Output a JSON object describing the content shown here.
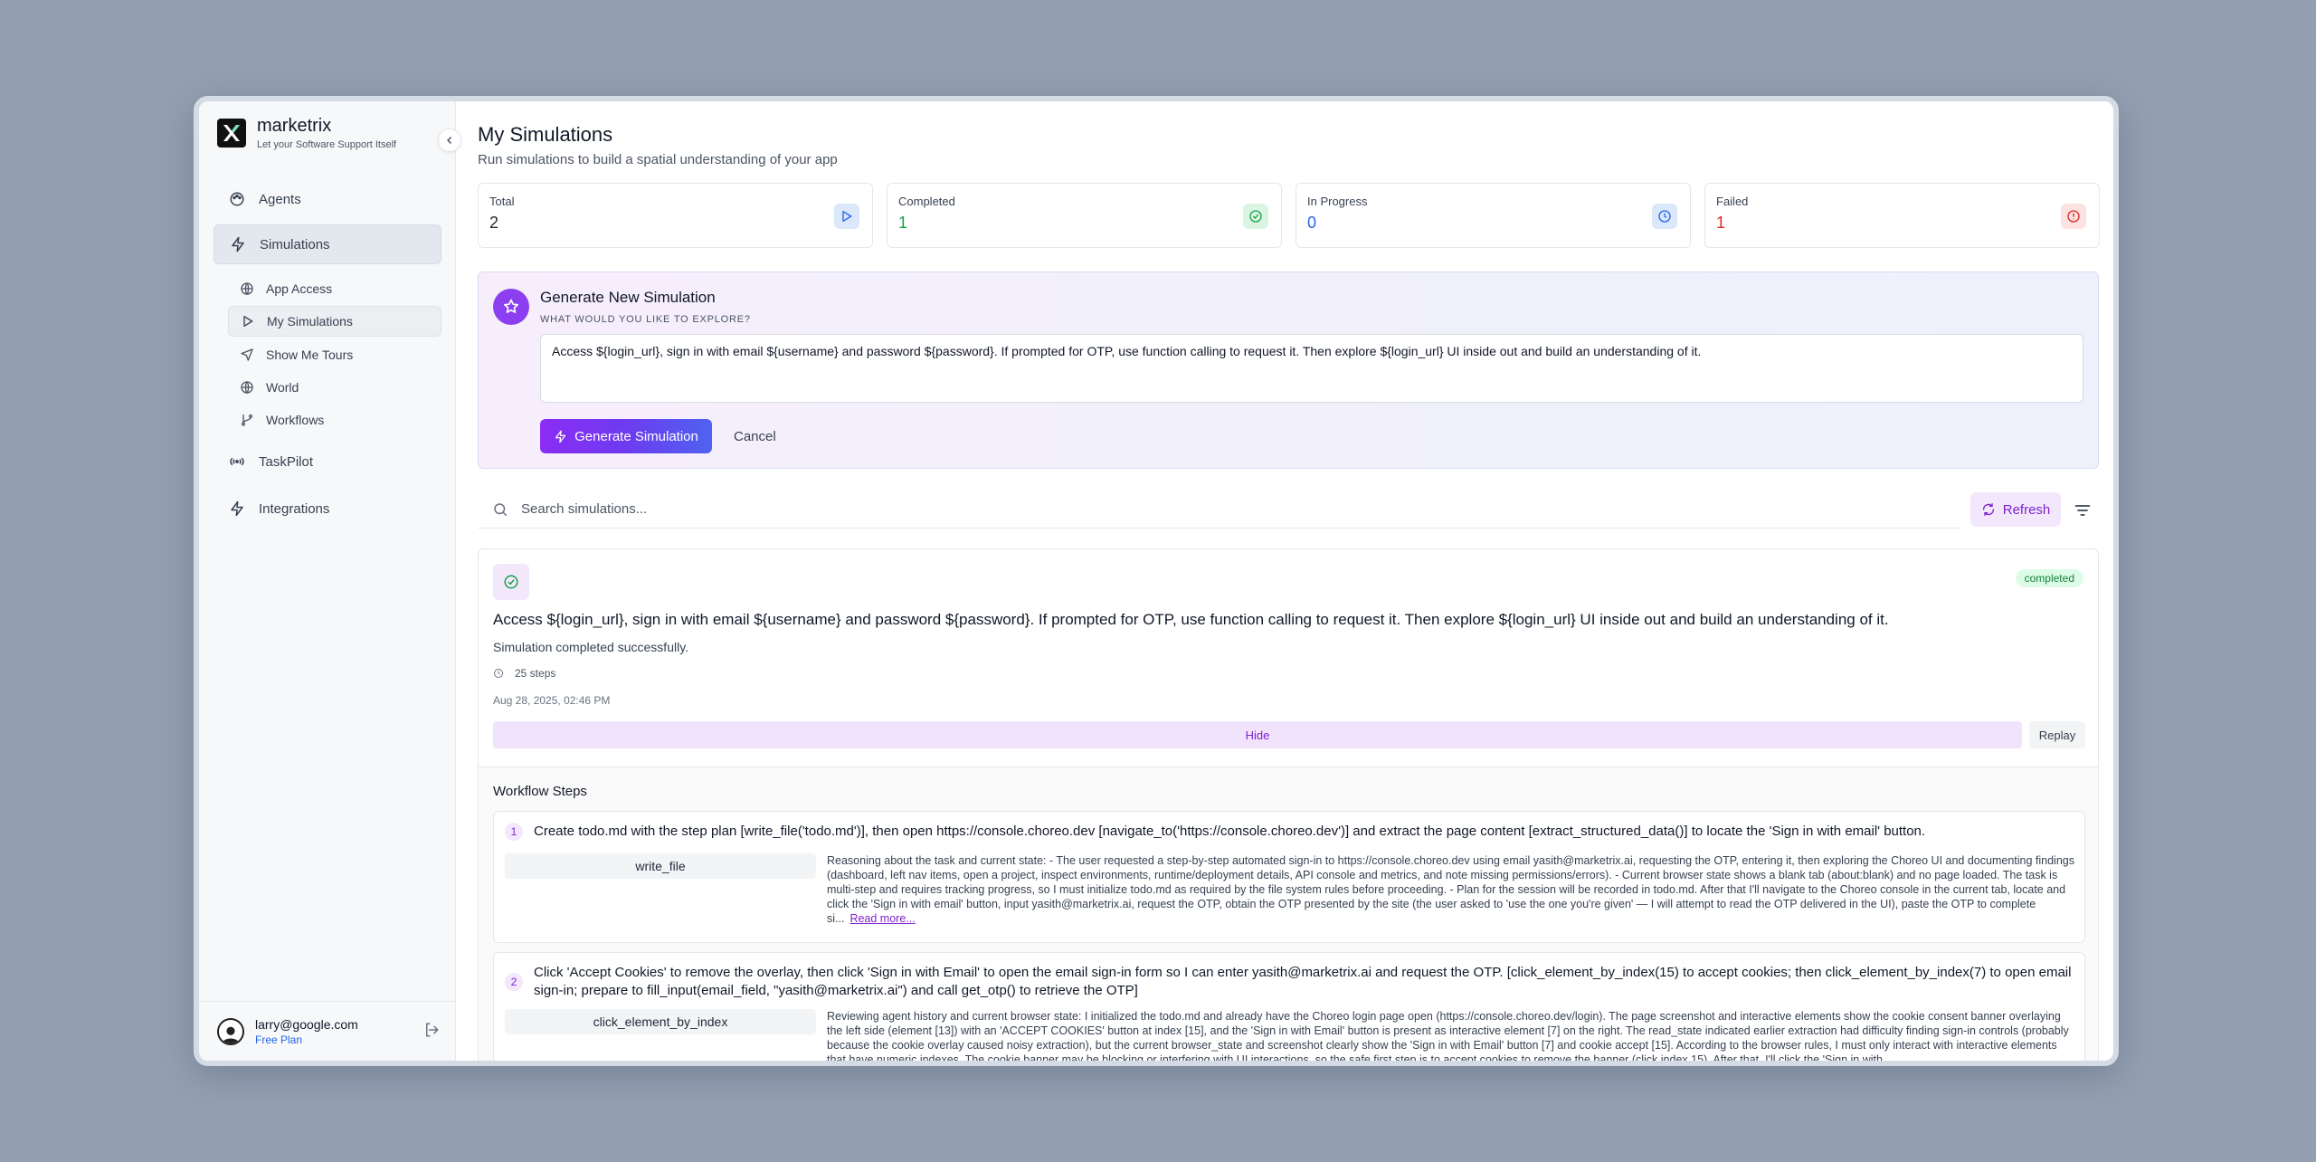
{
  "brand": {
    "name": "marketrix",
    "tagline": "Let your Software Support Itself"
  },
  "sidebar": {
    "items": [
      {
        "label": "Agents",
        "icon": "palette-icon"
      },
      {
        "label": "Simulations",
        "icon": "zap-icon",
        "active": true
      },
      {
        "label": "TaskPilot",
        "icon": "wave-icon"
      },
      {
        "label": "Integrations",
        "icon": "zap-icon"
      }
    ],
    "sub_items": [
      {
        "label": "App Access",
        "icon": "globe-icon"
      },
      {
        "label": "My Simulations",
        "icon": "play-icon",
        "active": true
      },
      {
        "label": "Show Me Tours",
        "icon": "send-icon"
      },
      {
        "label": "World",
        "icon": "globe-icon"
      },
      {
        "label": "Workflows",
        "icon": "git-branch-icon"
      }
    ]
  },
  "user": {
    "email": "larry@google.com",
    "plan": "Free Plan"
  },
  "page": {
    "title": "My Simulations",
    "subtitle": "Run simulations to build a spatial understanding of your app"
  },
  "stats": [
    {
      "label": "Total",
      "value": "2",
      "color": "#1f2937",
      "icon": "play-icon"
    },
    {
      "label": "Completed",
      "value": "1",
      "color": "#16a34a",
      "icon": "check-circle-icon"
    },
    {
      "label": "In Progress",
      "value": "0",
      "color": "#2563eb",
      "icon": "clock-icon"
    },
    {
      "label": "Failed",
      "value": "1",
      "color": "#dc2626",
      "icon": "alert-circle-icon"
    }
  ],
  "generate": {
    "title": "Generate New Simulation",
    "question": "WHAT WOULD YOU LIKE TO EXPLORE?",
    "prompt_value": "Access ${login_url}, sign in with email ${username} and password ${password}. If prompted for OTP, use function calling to request it. Then explore ${login_url} UI inside out and build an understanding of it.",
    "button_label": "Generate Simulation",
    "cancel_label": "Cancel"
  },
  "search": {
    "placeholder": "Search simulations...",
    "refresh_label": "Refresh"
  },
  "simulation": {
    "status": "completed",
    "prompt": "Access ${login_url}, sign in with email ${username} and password ${password}. If prompted for OTP, use function calling to request it. Then explore ${login_url} UI inside out and build an understanding of it.",
    "message": "Simulation completed successfully.",
    "steps": "25 steps",
    "date": "Aug 28, 2025, 02:46 PM",
    "hide_label": "Hide",
    "replay_label": "Replay"
  },
  "workflow": {
    "title": "Workflow Steps",
    "steps": [
      {
        "num": "1",
        "desc": "Create todo.md with the step plan [write_file('todo.md')], then open https://console.choreo.dev [navigate_to('https://console.choreo.dev')] and extract the page content [extract_structured_data()] to locate the 'Sign in with email' button.",
        "tool": "write_file",
        "reason": "Reasoning about the task and current state: - The user requested a step-by-step automated sign-in to https://console.choreo.dev using email yasith@marketrix.ai, requesting the OTP, entering it, then exploring the Choreo UI and documenting findings (dashboard, left nav items, open a project, inspect environments, runtime/deployment details, API console and metrics, and note missing permissions/errors). - Current browser state shows a blank tab (about:blank) and no page loaded. The task is multi-step and requires tracking progress, so I must initialize todo.md as required by the file system rules before proceeding. - Plan for the session will be recorded in todo.md. After that I'll navigate to the Choreo console in the current tab, locate and click the 'Sign in with email' button, input yasith@marketrix.ai, request the OTP, obtain the OTP presented by the site (the user asked to 'use the one you're given' — I will attempt to read the OTP delivered in the UI), paste the OTP to complete si...",
        "read_more": "Read more..."
      },
      {
        "num": "2",
        "desc": "Click 'Accept Cookies' to remove the overlay, then click 'Sign in with Email' to open the email sign-in form so I can enter yasith@marketrix.ai and request the OTP. [click_element_by_index(15) to accept cookies; then click_element_by_index(7) to open email sign-in; prepare to fill_input(email_field, \"yasith@marketrix.ai\") and call get_otp() to retrieve the OTP]",
        "tool": "click_element_by_index",
        "reason": "Reviewing agent history and current browser state: I initialized the todo.md and already have the Choreo login page open (https://console.choreo.dev/login). The page screenshot and interactive elements show the cookie consent banner overlaying the left side (element [13]) with an 'ACCEPT COOKIES' button at index [15], and the 'Sign in with Email' button is present as interactive element [7] on the right. The read_state indicated earlier extraction had difficulty finding sign-in controls (probably because the cookie overlay caused noisy extraction), but the current browser_state and screenshot clearly show the 'Sign in with Email' button [7] and cookie accept [15]. According to the browser rules, I must only interact with interactive elements that have numeric indexes. The cookie banner may be blocking or interfering with UI interactions, so the safe first step is to accept cookies to remove the banner (click index 15). After that, I'll click the 'Sign in with"
      }
    ]
  }
}
